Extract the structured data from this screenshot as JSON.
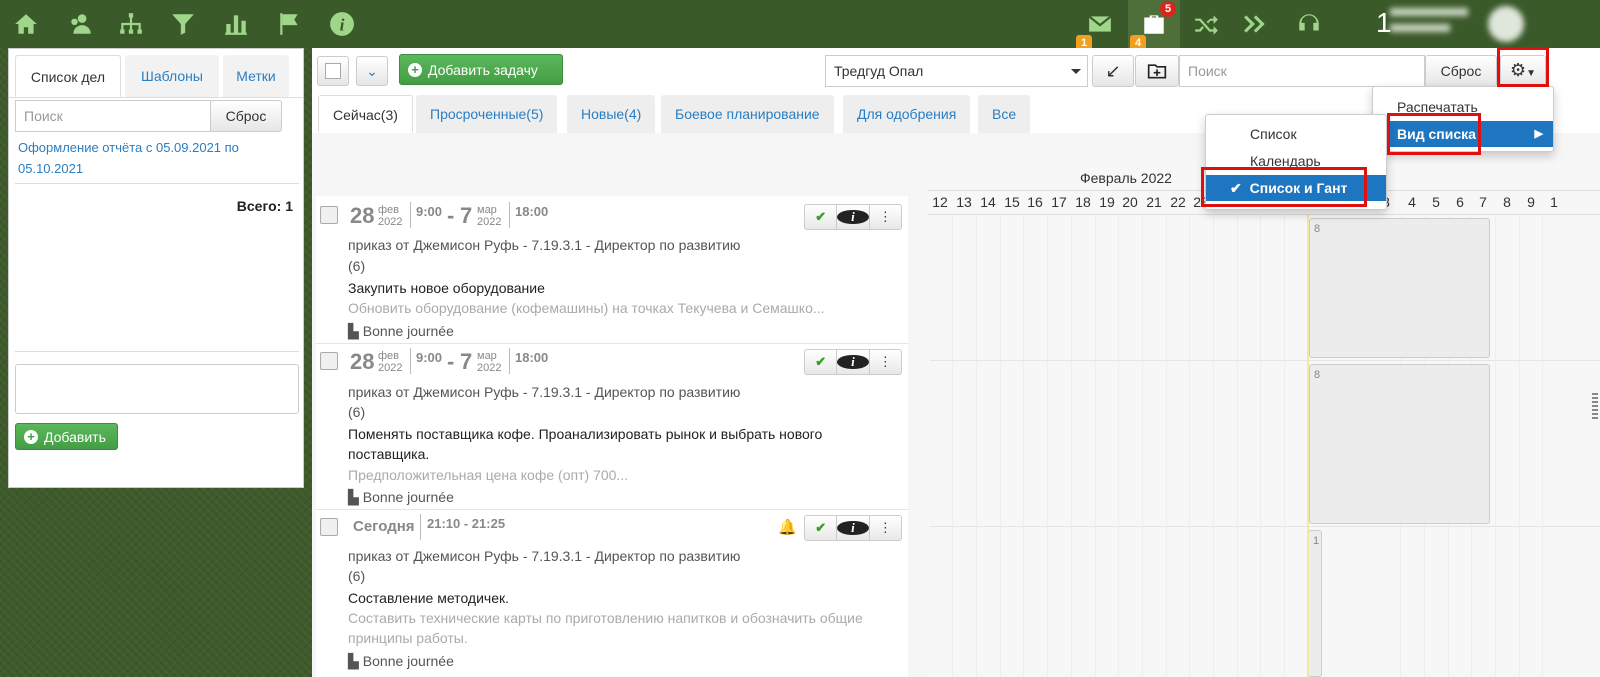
{
  "topbar": {
    "mail_badge": "1",
    "briefcase_badge_red": "5",
    "briefcase_badge_orange": "4",
    "user_count": "1"
  },
  "left_panel": {
    "tabs": [
      "Список дел",
      "Шаблоны",
      "Метки"
    ],
    "search_placeholder": "Поиск",
    "reset_label": "Сброс",
    "filter_link": "Оформление отчёта с 05.09.2021 по 05.10.2021",
    "total_label": "Всего: 1",
    "add_label": "Добавить"
  },
  "toolbar": {
    "add_task_label": "Добавить задачу",
    "user_select": "Тредгуд Опал",
    "search_placeholder": "Поиск",
    "reset_label": "Сброс"
  },
  "main_tabs": [
    "Сейчас(3)",
    "Просроченные(5)",
    "Новые(4)",
    "Боевое планирование",
    "Для одобрения",
    "Все"
  ],
  "tasks": [
    {
      "start_day": "28",
      "start_month": "фев",
      "start_year": "2022",
      "start_time": "9:00",
      "end_day": "7",
      "end_month": "мар",
      "end_year": "2022",
      "end_time": "18:00",
      "meta": "приказ от Джемисон Руфь - 7.19.3.1 - Директор по развитию",
      "count": "(6)",
      "title": "Закупить новое оборудование",
      "desc": "Обновить оборудование (кофемашины) на точках Текучева и Семашко...",
      "org": "Bonne journée"
    },
    {
      "start_day": "28",
      "start_month": "фев",
      "start_year": "2022",
      "start_time": "9:00",
      "end_day": "7",
      "end_month": "мар",
      "end_year": "2022",
      "end_time": "18:00",
      "meta": "приказ от Джемисон Руфь - 7.19.3.1 - Директор по развитию",
      "count": "(6)",
      "title": "Поменять поставщика кофе. Проанализировать рынок и выбрать нового поставщика.",
      "desc": "Предположительная цена кофе (опт) 700...",
      "org": "Bonne journée"
    },
    {
      "day_label": "Сегодня",
      "time_range": "21:10 - 21:25",
      "meta": "приказ от Джемисон Руфь - 7.19.3.1 - Директор по развитию",
      "count": "(6)",
      "title": "Составление методичек.",
      "desc": "Составить технические карты по приготовлению напитков и обозначить общие принципы работы.",
      "org": "Bonne journée"
    }
  ],
  "gantt": {
    "month": "Февраль 2022",
    "days_visible": [
      "12",
      "13",
      "14",
      "15",
      "16",
      "17",
      "18",
      "19",
      "20",
      "21",
      "22",
      "23",
      "3",
      "4",
      "5",
      "6",
      "7",
      "8",
      "9",
      "1"
    ],
    "bar_labels": [
      "8",
      "8",
      "1"
    ]
  },
  "settings_menu": {
    "items": [
      "Распечатать",
      "Вид списка"
    ],
    "submenu": [
      "Список",
      "Календарь",
      "Список и Гант"
    ],
    "selected": "Список и Гант"
  }
}
